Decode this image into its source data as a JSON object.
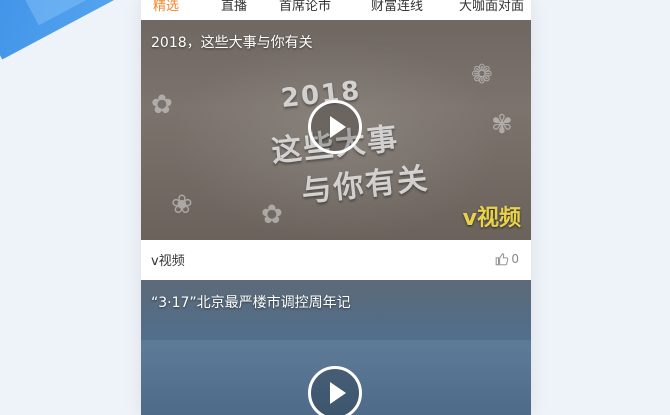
{
  "tabs": [
    {
      "label": "精选",
      "active": true
    },
    {
      "label": "直播",
      "active": false
    },
    {
      "label": "首席论市",
      "active": false
    },
    {
      "label": "财富连线",
      "active": false
    },
    {
      "label": "大咖面对面",
      "active": false
    }
  ],
  "accent_color": "#f5862d",
  "feed": [
    {
      "title": "2018，这些大事与你有关",
      "overlay_lines": [
        "2018",
        "这些大事",
        "与你有关"
      ],
      "brand_tag": "v视频",
      "source": "v视频",
      "likes": "0"
    },
    {
      "title": "“3·17”北京最严楼市调控周年记"
    }
  ],
  "icons": {
    "play": "play-icon",
    "like": "thumbs-up-icon"
  }
}
